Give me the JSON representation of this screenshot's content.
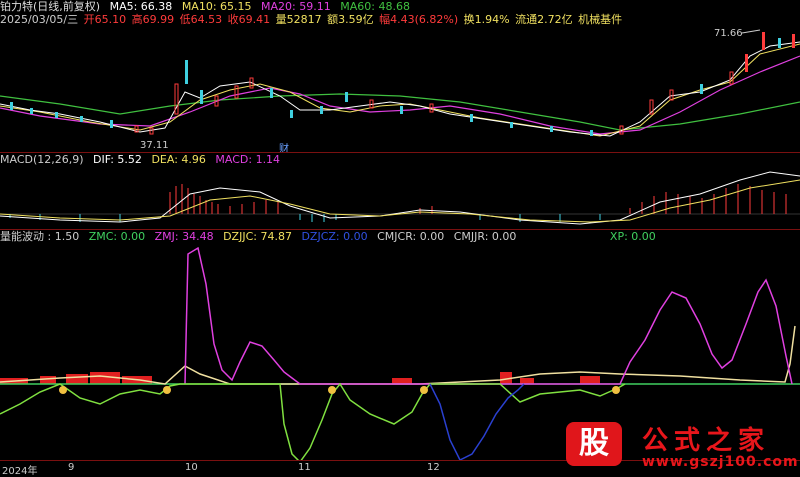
{
  "header": {
    "stock_name": "铂力特(日线,前复权)",
    "ma5": "MA5: 66.38",
    "ma10": "MA10: 65.15",
    "ma20": "MA20: 59.11",
    "ma60": "MA60: 48.68",
    "date": "2025/03/05/三",
    "open": "开65.10",
    "high": "高69.99",
    "low": "低64.53",
    "close": "收69.41",
    "volume": "量52817",
    "amount": "额3.59亿",
    "change": "幅4.43(6.82%)",
    "turnover": "换1.94%",
    "float": "流通2.72亿",
    "sector": "机械基件"
  },
  "price_pane": {
    "label_high": "71.66",
    "label_low": "37.11",
    "marker": "财"
  },
  "macd_pane": {
    "name": "MACD(12,26,9)",
    "dif": "DIF: 5.52",
    "dea": "DEA: 4.96",
    "macd": "MACD: 1.14"
  },
  "indicator_pane": {
    "name": "量能波动 : 1.50",
    "zmc": "ZMC: 0.00",
    "zmj": "ZMJ: 34.48",
    "dzjjc": "DZJJC: 74.87",
    "dzjcz": "DZJCZ: 0.00",
    "cmjcr": "CMJCR: 0.00",
    "cmjjr": "CMJJR: 0.00",
    "xp": "XP: 0.00"
  },
  "time_axis": {
    "year": "2024年",
    "m9": "9",
    "m10": "10",
    "m11": "11",
    "m12": "12"
  },
  "watermark": {
    "logo": "股",
    "title": "公式之家",
    "url": "www.gszj100.com"
  },
  "colors": {
    "up": "#ff3b3b",
    "down": "#3fd0e0",
    "ma5": "#ffffff",
    "ma10": "#f0e060",
    "ma20": "#e040e0",
    "ma60": "#40c040",
    "grid_border": "#7a1010"
  }
}
